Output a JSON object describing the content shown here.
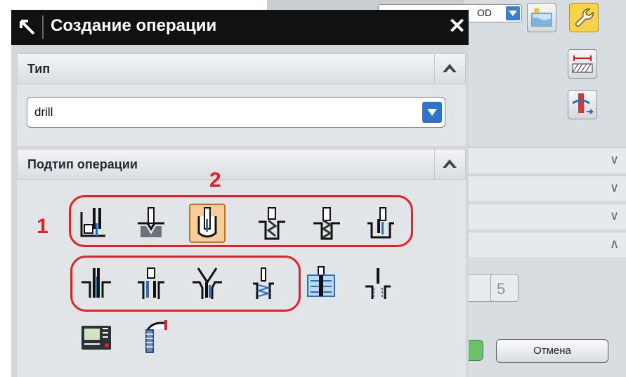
{
  "dialog": {
    "title": "Создание операции",
    "type_section": {
      "label": "Тип",
      "selected": "drill"
    },
    "subtype_section": {
      "label": "Подтип операции"
    },
    "operation_icons": [
      "spot-facing-icon",
      "spot-drilling-icon",
      "drilling-icon",
      "peck-drilling-icon",
      "break-chip-drilling-icon",
      "boring-icon",
      "reaming-icon",
      "counterboring-icon",
      "countersinking-icon",
      "tapping-icon",
      "thread-milling-icon",
      "hole-making-icon",
      "mill-control-icon",
      "drill-operation-icon"
    ]
  },
  "annotations": {
    "group_1": "1",
    "selected_2": "2"
  },
  "background": {
    "combo_value": "OD",
    "cancel_label": "Отмена"
  },
  "colors": {
    "annotation": "#e32226",
    "selected_fill": "#f4cf9c",
    "titlebar": "#111111"
  }
}
